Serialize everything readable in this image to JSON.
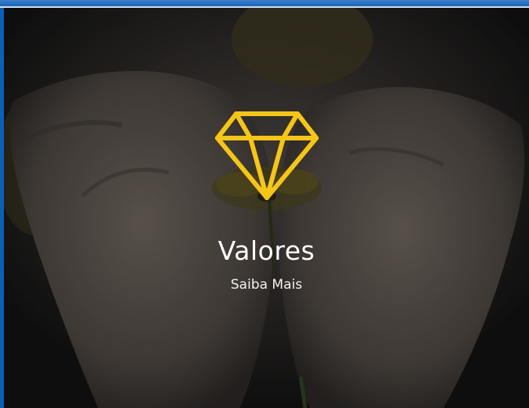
{
  "banner": {
    "title": "Valores",
    "link_label": "Saiba Mais",
    "icon": "diamond-icon",
    "icon_color": "#f5c518",
    "background_image": "open-hands-holding-yellow-flower"
  },
  "colors": {
    "window_border": "#0c5fb6",
    "text": "#ffffff"
  }
}
